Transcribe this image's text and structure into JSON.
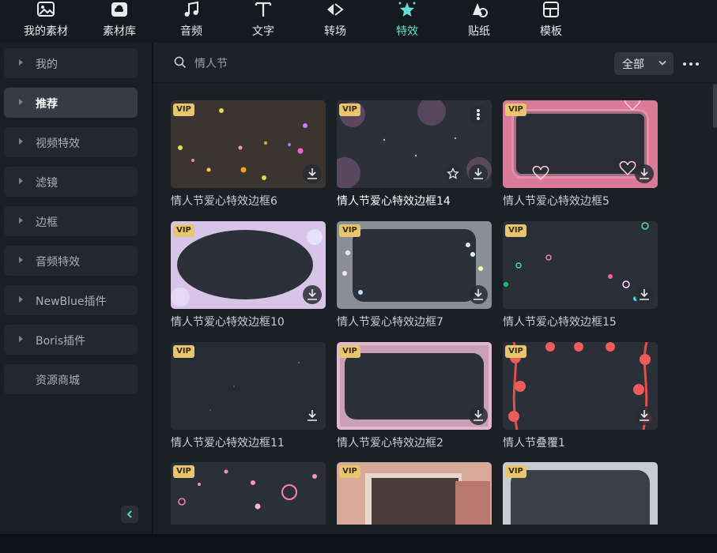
{
  "top_tabs": [
    {
      "label": "我的素材",
      "icon": "image-folder-icon"
    },
    {
      "label": "素材库",
      "icon": "cloud-folder-icon"
    },
    {
      "label": "音频",
      "icon": "music-note-icon"
    },
    {
      "label": "文字",
      "icon": "text-t-icon"
    },
    {
      "label": "转场",
      "icon": "transition-icon"
    },
    {
      "label": "特效",
      "icon": "sparkle-star-icon",
      "active": true
    },
    {
      "label": "贴纸",
      "icon": "sticker-icon"
    },
    {
      "label": "模板",
      "icon": "template-grid-icon"
    }
  ],
  "sidebar": {
    "items": [
      {
        "label": "我的",
        "arrow": true
      },
      {
        "label": "推荐",
        "arrow": true,
        "active": true
      },
      {
        "label": "视频特效",
        "arrow": true
      },
      {
        "label": "滤镜",
        "arrow": true
      },
      {
        "label": "边框",
        "arrow": true
      },
      {
        "label": "音频特效",
        "arrow": true
      },
      {
        "label": "NewBlue插件",
        "arrow": true
      },
      {
        "label": "Boris插件",
        "arrow": true
      },
      {
        "label": "资源商城",
        "arrow": false
      }
    ],
    "collapse_icon": "chevron-left-icon"
  },
  "search": {
    "value": "情人节",
    "icon": "search-icon"
  },
  "filter": {
    "selected": "全部",
    "icon": "chevron-down-icon"
  },
  "more_icon": "more-dots-icon",
  "vip_badge": "VIP",
  "colors": {
    "accent": "#5fe0d0",
    "vip": "#e8c66f",
    "background": "#1b2026",
    "sidebar_active": "#363c44"
  },
  "cards": [
    {
      "name": "情人节爱心特效边框6",
      "vip": true
    },
    {
      "name": "情人节爱心特效边框14",
      "vip": true,
      "hover": true
    },
    {
      "name": "情人节爱心特效边框5",
      "vip": true
    },
    {
      "name": "情人节爱心特效边框10",
      "vip": true
    },
    {
      "name": "情人节爱心特效边框7",
      "vip": true
    },
    {
      "name": "情人节爱心特效边框15",
      "vip": true
    },
    {
      "name": "情人节爱心特效边框11",
      "vip": true
    },
    {
      "name": "情人节爱心特效边框2",
      "vip": true
    },
    {
      "name": "情人节叠覆1",
      "vip": true
    },
    {
      "name": "",
      "vip": true
    },
    {
      "name": "",
      "vip": true
    },
    {
      "name": "",
      "vip": true
    }
  ]
}
